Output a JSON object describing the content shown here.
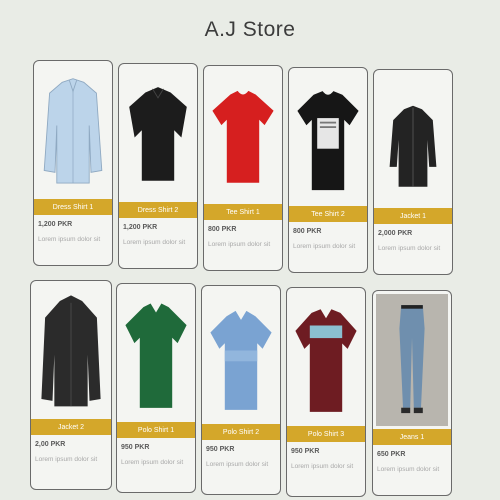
{
  "store": {
    "title": "A.J Store"
  },
  "products": [
    {
      "name": "Dress Shirt 1",
      "price": "1,200 PKR",
      "desc": "Lorem ipsum dolor sit"
    },
    {
      "name": "Dress Shirt 2",
      "price": "1,200 PKR",
      "desc": "Lorem ipsum dolor sit"
    },
    {
      "name": "Tee Shirt 1",
      "price": "800 PKR",
      "desc": "Lorem ipsum dolor sit"
    },
    {
      "name": "Tee Shirt 2",
      "price": "800 PKR",
      "desc": "Lorem ipsum dolor sit"
    },
    {
      "name": "Jacket 1",
      "price": "2,000 PKR",
      "desc": "Lorem ipsum dolor sit"
    },
    {
      "name": "Jacket 2",
      "price": "2,00 PKR",
      "desc": "Lorem ipsum dolor sit"
    },
    {
      "name": "Polo Shirt 1",
      "price": "950 PKR",
      "desc": "Lorem ipsum dolor sit"
    },
    {
      "name": "Polo Shirt 2",
      "price": "950 PKR",
      "desc": "Lorem ipsum dolor sit"
    },
    {
      "name": "Polo Shirt 3",
      "price": "950 PKR",
      "desc": "Lorem ipsum dolor sit"
    },
    {
      "name": "Jeans 1",
      "price": "650 PKR",
      "desc": "Lorem ipsum dolor sit"
    }
  ],
  "colors": {
    "accent_bar": "#d4a72a",
    "background": "#e9ece6"
  },
  "icons": [
    "dress-shirt-image",
    "tee-shirt-image",
    "jacket-image",
    "polo-shirt-image",
    "jeans-image"
  ]
}
